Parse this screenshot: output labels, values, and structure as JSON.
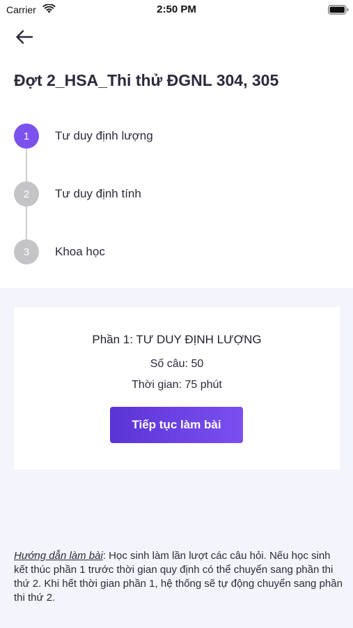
{
  "status_bar": {
    "carrier": "Carrier",
    "time": "2:50 PM"
  },
  "header": {
    "back_icon": "arrow-left-icon",
    "title": "Đợt 2_HSA_Thi thử ĐGNL 304, 305"
  },
  "steps": [
    {
      "number": "1",
      "label": "Tư duy định lượng",
      "active": true
    },
    {
      "number": "2",
      "label": "Tư duy định tính",
      "active": false
    },
    {
      "number": "3",
      "label": "Khoa học",
      "active": false
    }
  ],
  "colors": {
    "accent": "#7b52ee",
    "inactive_step": "#c4c4c6",
    "section_bg": "#f4f4fd"
  },
  "card": {
    "title": "Phần 1: TƯ DUY ĐỊNH LƯỢNG",
    "question_count": "Số câu: 50",
    "duration": "Thời gian: 75 phút",
    "continue_label": "Tiếp tục làm bài"
  },
  "instructions": {
    "label": "Hướng dẫn làm bài",
    "text": ": Học sinh làm lần lượt các câu hỏi. Nếu học sinh kết thúc phần 1 trước thời gian quy định có thể chuyển sang phần thi thứ 2. Khi hết thời gian phần 1, hệ thống sẽ tự động chuyển sang phần thi thứ 2."
  }
}
